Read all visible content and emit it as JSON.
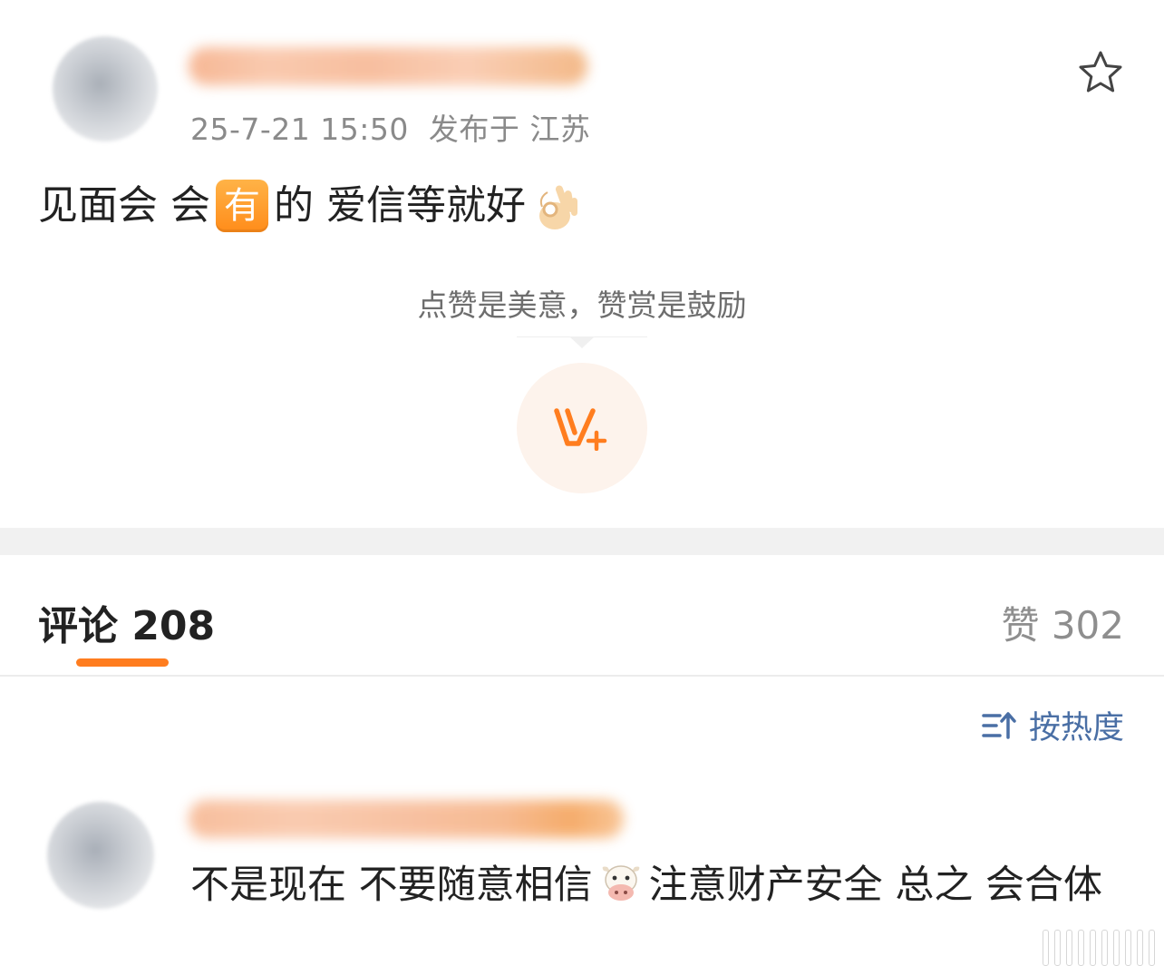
{
  "post": {
    "timestamp": "25-7-21 15:50",
    "location": "发布于 江苏",
    "text_before": "见面会 会",
    "badge": "有",
    "text_after": "的 爱信等就好"
  },
  "reward": {
    "hint": "点赞是美意，赞赏是鼓励"
  },
  "tabs": {
    "comments_label": "评论 208",
    "likes_label": "赞 302"
  },
  "sort": {
    "label": "按热度"
  },
  "comment": {
    "text_before": "不是现在 不要随意相信",
    "text_after": "注意财产安全 总之 会合体"
  },
  "colors": {
    "accent": "#ff7d1f",
    "link": "#4a6fa5",
    "meta": "#8a8a8a"
  }
}
